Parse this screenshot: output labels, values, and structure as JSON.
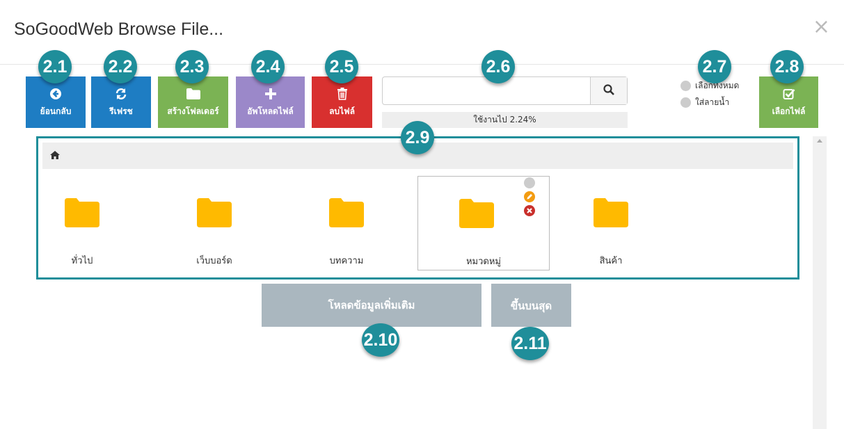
{
  "dialog": {
    "title": "SoGoodWeb Browse File...",
    "close_symbol": "×"
  },
  "toolbar": {
    "back": {
      "label": "ย้อนกลับ",
      "color": "#1e7dc3",
      "icon": "arrow-circle-left-icon"
    },
    "refresh": {
      "label": "รีเฟรช",
      "color": "#1e7dc3",
      "icon": "refresh-icon"
    },
    "new_folder": {
      "label": "สร้างโฟลเดอร์",
      "color": "#7bb354",
      "icon": "folder-icon"
    },
    "upload": {
      "label": "อัพโหลดไฟล์",
      "color": "#9b88c9",
      "icon": "plus-icon"
    },
    "delete": {
      "label": "ลบไฟล์",
      "color": "#d8302f",
      "icon": "trash-icon"
    },
    "select_file": {
      "label": "เลือกไฟล์",
      "color": "#7bb354",
      "icon": "check-square-icon"
    }
  },
  "search": {
    "value": "",
    "placeholder": "",
    "icon": "search-icon"
  },
  "usage": {
    "text": "ใช้งานไป 2.24%",
    "percent": 2.24
  },
  "options": {
    "select_all": "เลือกทั้งหมด",
    "watermark": "ใส่ลายน้ำ"
  },
  "breadcrumb": {
    "icon": "home-icon"
  },
  "folders": [
    {
      "name": "ทั่วไป",
      "selected": false
    },
    {
      "name": "เว็บบอร์ด",
      "selected": false
    },
    {
      "name": "บทความ",
      "selected": false
    },
    {
      "name": "หมวดหมู่",
      "selected": true
    },
    {
      "name": "สินค้า",
      "selected": false
    }
  ],
  "folder_color": "#ffba00",
  "buttons": {
    "load_more": "โหลดข้อมูลเพิ่มเติม",
    "to_top": "ขึ้นบนสุด"
  },
  "annotations": [
    "2.1",
    "2.2",
    "2.3",
    "2.4",
    "2.5",
    "2.6",
    "2.7",
    "2.8",
    "2.9",
    "2.10",
    "2.11"
  ],
  "accent": "#1f8e9a"
}
